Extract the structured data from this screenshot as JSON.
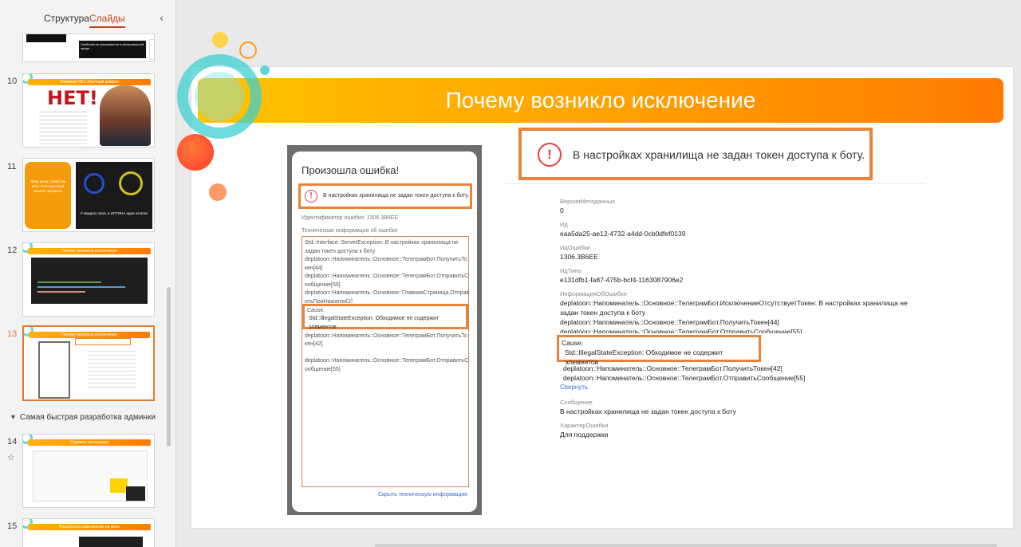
{
  "panel": {
    "tab_structure": "Структура",
    "tab_slides": "Слайды",
    "collapse_glyph": "‹"
  },
  "thumbnails": [
    {
      "number": "",
      "banner": "",
      "caption_top": "",
      "caption_main": "Свойства не указываются в материальной среде"
    },
    {
      "number": "10",
      "banner": "Снимаем НЕТ обычный момент",
      "main": "НЕТ!"
    },
    {
      "number": "11",
      "banner": "",
      "left_text": "Иниц разм. Свойства могут в конкретный момент времени",
      "right_text": "У каждого своя, а ИСТИНА одна на всех"
    },
    {
      "number": "12",
      "banner": "Почему возникло исключение"
    },
    {
      "number": "13",
      "banner": "Почему возникло исключение"
    },
    {
      "number": "14",
      "banner": "Сервисы инструкции"
    },
    {
      "number": "15",
      "banner": "Разработка приложения на день"
    }
  ],
  "section": {
    "toggle_glyph": "▼",
    "title": "Самая быстрая разработка админки"
  },
  "slide": {
    "title": "Почему возникло исключение",
    "phone": {
      "title": "Произошла ошибка!",
      "alert_text": "В настройках хранилища не задан токен доступа к боту.",
      "error_id": "Идентификатор ошибки: 1306.3B6EE",
      "tech_label": "Техническая информация об ошибке",
      "tech_lines_before": [
        "Std::Interface::ServerException: В настройках хранилища не",
        "задан токен доступа к боту",
        "deplatoon::Напоминатель::Основное::ТелеграмБот.ПолучитьТо",
        "кен[44]",
        "deplatoon::Напоминатель::Основное::ТелеграмБот.ОтправитьС",
        "ообщение[55]",
        "deplatoon::Напоминатель::Основное::ГлавнаяСтраница.Отправ",
        "итьПриНажатии[2]"
      ],
      "cause_label": "Cause:",
      "cause_text": "Std::IllegalStateException: Обходимое не содержит элементов",
      "tech_lines_after": [
        "deplatoon::Напоминатель::Основное::ТелеграмБот.ПолучитьТо",
        "кен[42]",
        "",
        "deplatoon::Напоминатель::Основное::ТелеграмБот.ОтправитьС",
        "ообщение[55]"
      ],
      "hide_link": "Скрыть техническую информацию"
    },
    "big_alert_text": "В настройках хранилища не задан токен доступа к боту.",
    "details": {
      "meta_version_label": "ВерсияМетаданных",
      "meta_version_value": "0",
      "id_label": "Ид",
      "id_value": "eaa5da25-ae12-4732-a4dd-0cb0dfef0139",
      "error_id_label": "ИдОшибки",
      "error_id_value": "1306.3B6EE",
      "type_id_label": "ИдТипа",
      "type_id_value": "e131dfb1-fa87-475b-bcf4-1163087906e2",
      "info_label": "ИнформацияОбОшибке",
      "info_lines": [
        "deplatoon::Напоминатель::Основное::ТелеграмБот.ИсключениеОтсутствуетТокен: В настройках хранилища не",
        "задан токен доступа к боту",
        "deplatoon::Напоминатель::Основное::ТелеграмБот.ПолучитьТокен[44]",
        "deplatoon::Напоминатель::Основное::ТелеграмБот.ОтправитьСообщение[55]"
      ],
      "cause_label": "Cause:",
      "cause_text": "Std::IllegalStateException: Обходимое не содержит элементов",
      "info_after": [
        "deplatoon::Напоминатель::Основное::ТелеграмБот.ПолучитьТокен[42]",
        "deplatoon::Напоминатель::Основное::ТелеграмБот.ОтправитьСообщение[55]"
      ],
      "collapse_link": "Свернуть",
      "message_label": "Сообщение",
      "message_value": "В настройках хранилища не задан токен доступа к боту",
      "nature_label": "ХарактерОшибки",
      "nature_value": "Для поддержки"
    }
  },
  "colors": {
    "accent": "#e8833a",
    "active_tab": "#c4451c",
    "link": "#3a6fd0",
    "error": "#e04040"
  }
}
